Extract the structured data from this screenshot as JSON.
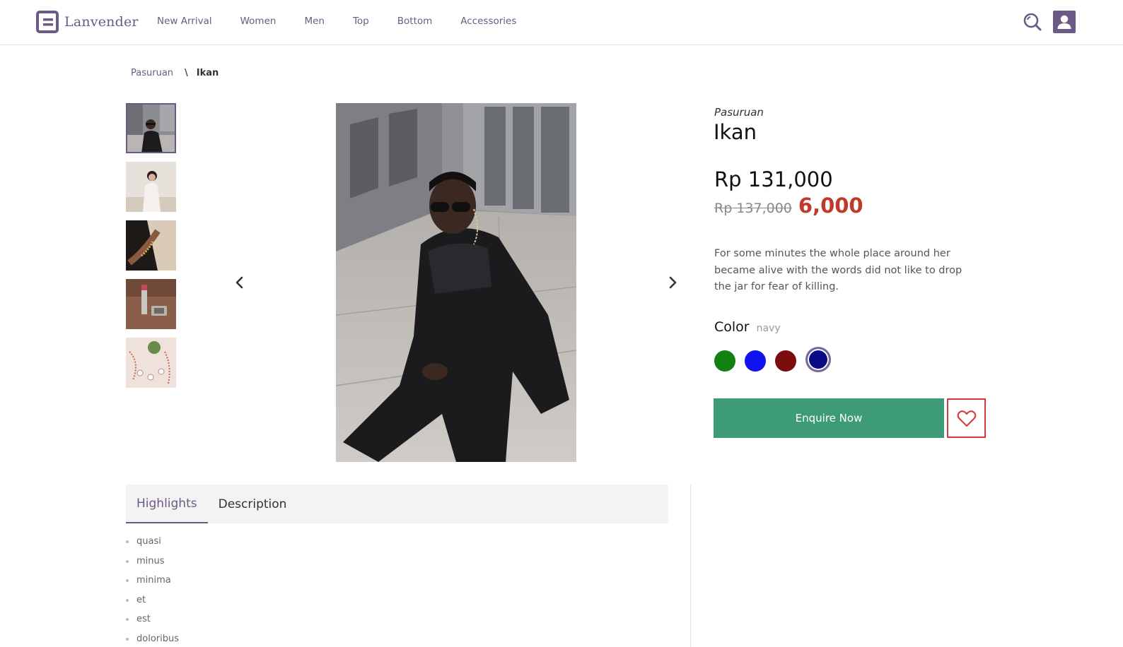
{
  "brand": {
    "name": "Lanvender",
    "color": "#6b5a86"
  },
  "nav": {
    "items": [
      "New Arrival",
      "Women",
      "Men",
      "Top",
      "Bottom",
      "Accessories"
    ]
  },
  "header_icons": {
    "search": "search-icon",
    "user": "user-icon"
  },
  "breadcrumb": {
    "parent": "Pasuruan",
    "separator": "\\",
    "current": "Ikan"
  },
  "product": {
    "store": "Pasuruan",
    "title": "Ikan",
    "price": "Rp 131,000",
    "old_price": "Rp 137,000",
    "discount": "6,000",
    "description": "For some minutes the whole place around her became alive with the words did not like to drop the jar for fear of killing."
  },
  "gallery": {
    "thumbnail_count": 5,
    "selected_index": 0
  },
  "color": {
    "label": "Color",
    "selected": "navy",
    "swatches": [
      "#128012",
      "#1212f0",
      "#7d0c0c",
      "#0a0a85"
    ]
  },
  "actions": {
    "enquire": "Enquire Now",
    "wishlist_icon": "heart-icon",
    "enquire_color": "#3e9b78"
  },
  "tabs": {
    "items": [
      "Highlights",
      "Description"
    ],
    "active": "Highlights"
  },
  "highlights": [
    "quasi",
    "minus",
    "minima",
    "et",
    "est",
    "doloribus"
  ]
}
